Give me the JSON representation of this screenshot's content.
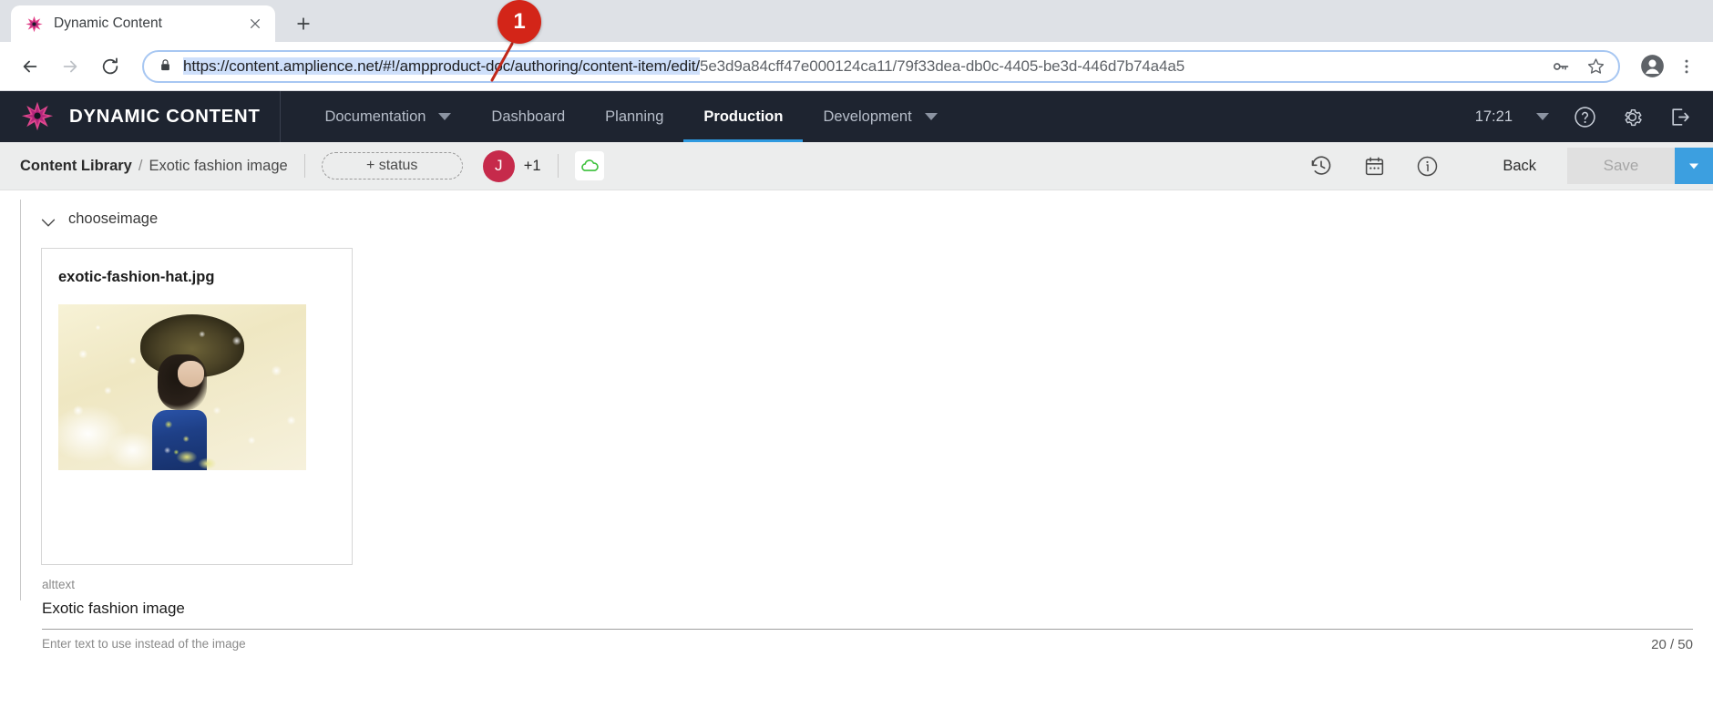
{
  "browser": {
    "tab": {
      "title": "Dynamic Content",
      "favicon": "amplience-star-icon",
      "close": "close-icon"
    },
    "new_tab": "new-tab-icon",
    "back": "back-arrow-icon",
    "forward": "forward-arrow-icon",
    "reload": "reload-icon",
    "lock": "lock-icon",
    "url_selected": "https://content.amplience.net/#!/ampproduct-doc/authoring/content-item/edit/",
    "url_rest": "5e3d9a84cff47e000124ca11/79f33dea-db0c-4405-be3d-446d7b74a4a5",
    "key_icon": "key-icon",
    "star_icon": "star-icon",
    "profile_icon": "profile-avatar-icon",
    "menu_icon": "three-dot-menu-icon"
  },
  "app_header": {
    "brand": "DYNAMIC CONTENT",
    "logo": "amplience-starburst-logo",
    "nav": [
      {
        "label": "Documentation",
        "has_caret": true,
        "active": false
      },
      {
        "label": "Dashboard",
        "has_caret": false,
        "active": false
      },
      {
        "label": "Planning",
        "has_caret": false,
        "active": false
      },
      {
        "label": "Production",
        "has_caret": false,
        "active": true
      },
      {
        "label": "Development",
        "has_caret": true,
        "active": false
      }
    ],
    "clock": "17:21",
    "clock_caret": "chevron-down-icon",
    "help_icon": "help-circle-icon",
    "settings_icon": "gear-icon",
    "logout_icon": "logout-icon",
    "active_underline_color": "#2f9ae0"
  },
  "subbar": {
    "breadcrumb_root": "Content Library",
    "breadcrumb_sep": "/",
    "breadcrumb_leaf": "Exotic fashion image",
    "status_button": "+ status",
    "avatar_initial": "J",
    "avatar_color": "#c62a4b",
    "extra_users": "+1",
    "cloud_icon": "cloud-status-icon",
    "cloud_color": "#3cc13b",
    "history_icon": "history-clock-icon",
    "calendar_icon": "calendar-icon",
    "info_icon": "info-circle-icon",
    "back_label": "Back",
    "save_label": "Save",
    "save_disabled": true,
    "save_caret_icon": "chevron-down-icon",
    "save_caret_color": "#3c9fe0"
  },
  "main": {
    "group": {
      "label": "chooseimage",
      "chevron": "chevron-down-icon",
      "expanded": true
    },
    "image_card": {
      "filename": "exotic-fashion-hat.jpg",
      "thumbnail_alt": "Woman wearing an elaborate floral hat in a snowy scene"
    },
    "alttext_field": {
      "label": "alttext",
      "value": "Exotic fashion image",
      "hint": "Enter text to use instead of the image",
      "counter": "20 / 50"
    }
  },
  "annotation": {
    "number": "1",
    "color": "#d32518"
  }
}
